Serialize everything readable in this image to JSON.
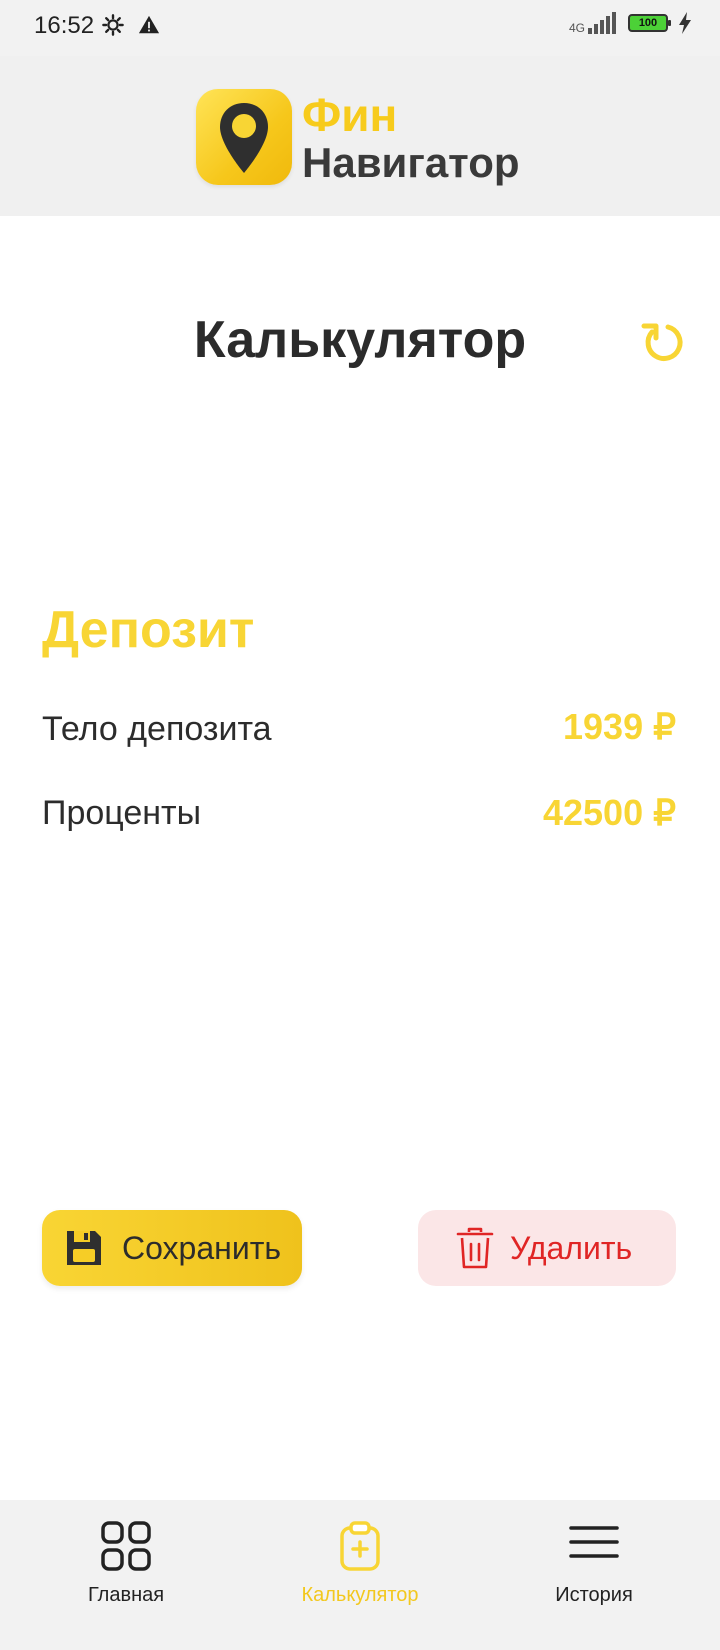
{
  "status_bar": {
    "time": "16:52",
    "network": "4G",
    "battery": "100"
  },
  "header": {
    "logo_line1": "Фин",
    "logo_line2": "Навигатор"
  },
  "page": {
    "title": "Калькулятор"
  },
  "deposit": {
    "title": "Депозит",
    "rows": [
      {
        "label": "Тело депозита",
        "value": "1939 ₽"
      },
      {
        "label": "Проценты",
        "value": "42500 ₽"
      }
    ]
  },
  "actions": {
    "save_label": "Сохранить",
    "delete_label": "Удалить"
  },
  "nav": {
    "items": [
      {
        "label": "Главная",
        "icon": "grid-icon",
        "active": false
      },
      {
        "label": "Калькулятор",
        "icon": "clipboard-plus-icon",
        "active": true
      },
      {
        "label": "История",
        "icon": "menu-icon",
        "active": false
      }
    ]
  },
  "colors": {
    "accent": "#f8d534",
    "danger": "#e02525",
    "text": "#2c2c2c",
    "danger_bg": "#fbe6e7"
  }
}
